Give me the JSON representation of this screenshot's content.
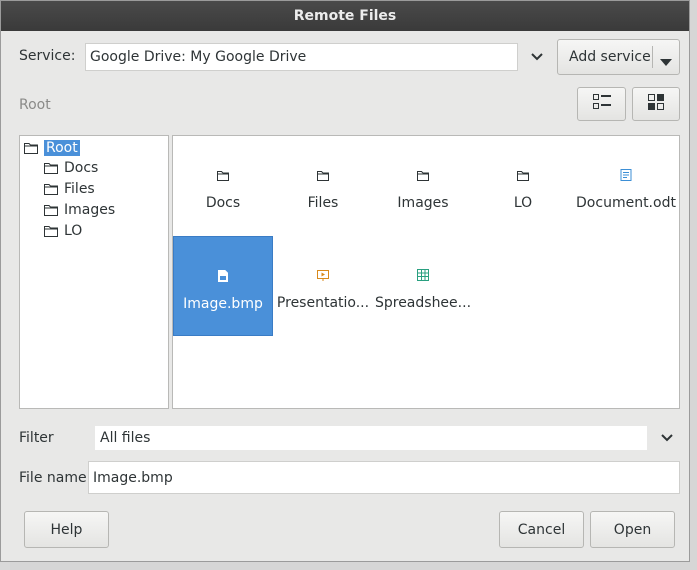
{
  "window": {
    "title": "Remote Files"
  },
  "service": {
    "label": "Service:",
    "value": "Google Drive: My Google Drive",
    "add_button": "Add service"
  },
  "path": {
    "breadcrumb": "Root"
  },
  "tree": {
    "root": "Root",
    "items": [
      "Docs",
      "Files",
      "Images",
      "LO"
    ]
  },
  "grid": {
    "items": [
      {
        "label": "Docs",
        "icon": "folder-icon"
      },
      {
        "label": "Files",
        "icon": "folder-icon"
      },
      {
        "label": "Images",
        "icon": "folder-icon"
      },
      {
        "label": "LO",
        "icon": "folder-icon"
      },
      {
        "label": "Document.odt",
        "icon": "text-document-icon"
      },
      {
        "label": "Image.bmp",
        "icon": "image-file-icon",
        "selected": true
      },
      {
        "label": "Presentatio...",
        "icon": "presentation-icon"
      },
      {
        "label": "Spreadshee...",
        "icon": "spreadsheet-icon"
      }
    ]
  },
  "filter": {
    "label": "Filter",
    "value": "All files"
  },
  "filename": {
    "label": "File name",
    "value": "Image.bmp"
  },
  "buttons": {
    "help": "Help",
    "cancel": "Cancel",
    "open": "Open"
  },
  "colors": {
    "selection": "#4a90d9",
    "titlebar": "#3c3c3c",
    "doc_icon": "#3c8fd6",
    "presentation_icon": "#d98a1b",
    "spreadsheet_icon": "#2aa080"
  }
}
